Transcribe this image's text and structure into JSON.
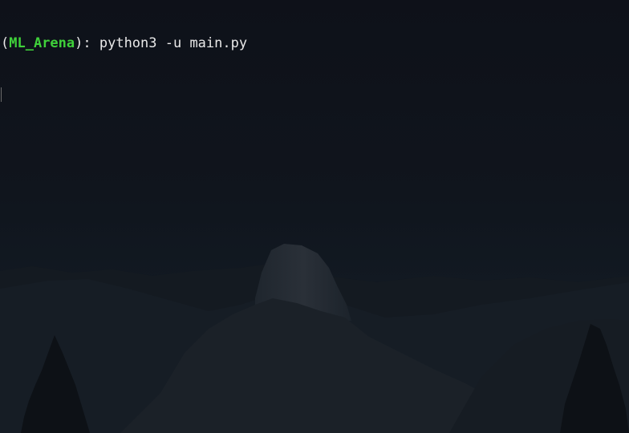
{
  "terminal": {
    "prompt_open": "(",
    "env_name": "ML_Arena",
    "prompt_close": "): ",
    "command": "python3 -u main.py"
  },
  "colors": {
    "background": "#0f131b",
    "env_name": "#3fd13a",
    "text": "#e9e9e9"
  },
  "wallpaper": {
    "icon": "mountain-landscape-wallpaper"
  }
}
